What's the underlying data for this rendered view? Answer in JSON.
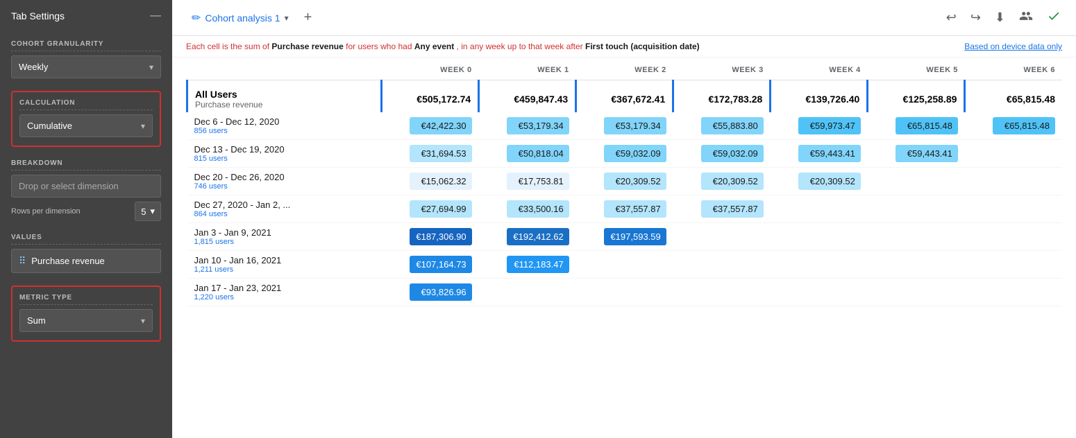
{
  "sidebar": {
    "title": "Tab Settings",
    "close_label": "—",
    "cohort_granularity": {
      "label": "COHORT GRANULARITY",
      "value": "Weekly"
    },
    "calculation": {
      "label": "CALCULATION",
      "value": "Cumulative"
    },
    "breakdown": {
      "label": "BREAKDOWN",
      "placeholder": "Drop or select dimension"
    },
    "rows_per_dimension": {
      "label": "Rows per dimension",
      "value": "5"
    },
    "values": {
      "label": "VALUES",
      "item": "Purchase revenue"
    },
    "metric_type": {
      "label": "METRIC TYPE",
      "value": "Sum"
    }
  },
  "topbar": {
    "tab_label": "Cohort analysis 1",
    "add_label": "+",
    "actions": {
      "undo": "↩",
      "redo": "↪",
      "download": "⬇",
      "share": "👥",
      "save": "✓"
    }
  },
  "description": {
    "text_parts": [
      "Each cell is the sum of ",
      "Purchase revenue",
      " for users who had ",
      "Any event",
      ", in any week up to that week after ",
      "First touch (acquisition date)"
    ],
    "link": "Based on device data only"
  },
  "table": {
    "columns": [
      "",
      "WEEK 0",
      "WEEK 1",
      "WEEK 2",
      "WEEK 3",
      "WEEK 4",
      "WEEK 5",
      "WEEK 6"
    ],
    "all_users": {
      "name": "All Users",
      "sub": "Purchase revenue",
      "values": [
        "€505,172.74",
        "€459,847.43",
        "€367,672.41",
        "€172,783.28",
        "€139,726.40",
        "€125,258.89",
        "€65,815.48"
      ]
    },
    "rows": [
      {
        "label": "Dec 6 - Dec 12, 2020",
        "sub": "856 users",
        "values": [
          "€42,422.30",
          "€53,179.34",
          "€53,179.34",
          "€55,883.80",
          "€59,973.47",
          "€65,815.48",
          "€65,815.48"
        ],
        "shades": [
          "d3",
          "d3",
          "d3",
          "d3",
          "d4",
          "d4",
          "d4"
        ]
      },
      {
        "label": "Dec 13 - Dec 19, 2020",
        "sub": "815 users",
        "values": [
          "€31,694.53",
          "€50,818.04",
          "€59,032.09",
          "€59,032.09",
          "€59,443.41",
          "€59,443.41",
          ""
        ],
        "shades": [
          "d2",
          "d3",
          "d3",
          "d3",
          "d3",
          "d3",
          ""
        ]
      },
      {
        "label": "Dec 20 - Dec 26, 2020",
        "sub": "746 users",
        "values": [
          "€15,062.32",
          "€17,753.81",
          "€20,309.52",
          "€20,309.52",
          "€20,309.52",
          "",
          ""
        ],
        "shades": [
          "d1",
          "d1",
          "d2",
          "d2",
          "d2",
          "",
          ""
        ]
      },
      {
        "label": "Dec 27, 2020 - Jan 2, ...",
        "sub": "864 users",
        "values": [
          "€27,694.99",
          "€33,500.16",
          "€37,557.87",
          "€37,557.87",
          "",
          "",
          ""
        ],
        "shades": [
          "d2",
          "d2",
          "d2",
          "d2",
          "",
          "",
          ""
        ]
      },
      {
        "label": "Jan 3 - Jan 9, 2021",
        "sub": "1,815 users",
        "values": [
          "€187,306.90",
          "€192,412.62",
          "€197,593.59",
          "",
          "",
          "",
          ""
        ],
        "shades": [
          "dark1",
          "dark2",
          "dark3",
          "",
          "",
          "",
          ""
        ]
      },
      {
        "label": "Jan 10 - Jan 16, 2021",
        "sub": "1,211 users",
        "values": [
          "€107,164.73",
          "€112,183.47",
          "",
          "",
          "",
          "",
          ""
        ],
        "shades": [
          "blue1",
          "blue2",
          "",
          "",
          "",
          "",
          ""
        ]
      },
      {
        "label": "Jan 17 - Jan 23, 2021",
        "sub": "1,220 users",
        "values": [
          "€93,826.96",
          "",
          "",
          "",
          "",
          "",
          ""
        ],
        "shades": [
          "blue1",
          "",
          "",
          "",
          "",
          "",
          ""
        ]
      }
    ]
  }
}
